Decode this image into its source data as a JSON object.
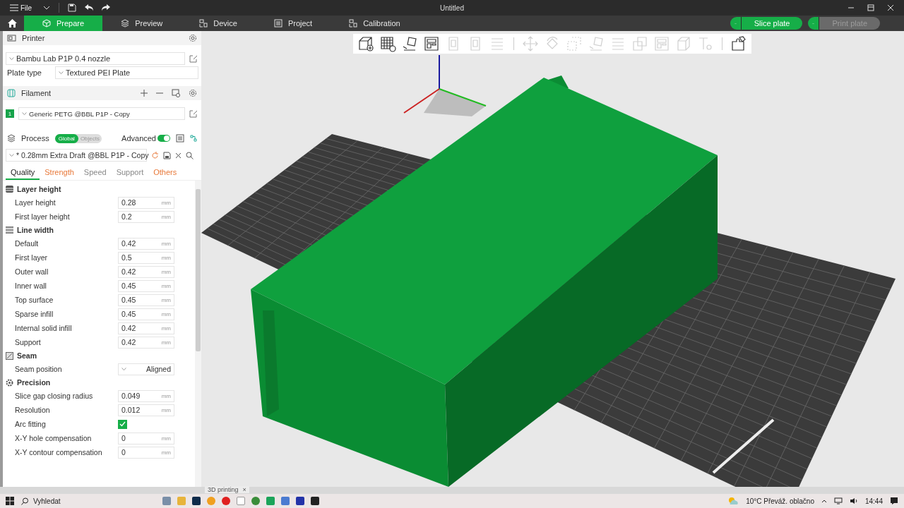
{
  "titlebar": {
    "menu": "File",
    "title": "Untitled"
  },
  "tabs": [
    {
      "label": "Prepare",
      "selected": true
    },
    {
      "label": "Preview",
      "selected": false
    },
    {
      "label": "Device",
      "selected": false
    },
    {
      "label": "Project",
      "selected": false
    },
    {
      "label": "Calibration",
      "selected": false
    }
  ],
  "actions": [
    {
      "label": "Slice plate",
      "disabled": false
    },
    {
      "label": "Print plate",
      "disabled": true
    }
  ],
  "printer": {
    "title": "Printer",
    "preset": "Bambu Lab P1P 0.4 nozzle",
    "plate_label": "Plate type",
    "plate": "Textured PEI Plate"
  },
  "filament": {
    "title": "Filament",
    "items": [
      {
        "index": "1",
        "name": "Generic PETG @BBL P1P - Copy",
        "color": "#16a34a"
      }
    ]
  },
  "process": {
    "title": "Process",
    "scopes": [
      {
        "label": "Global",
        "selected": true
      },
      {
        "label": "Objects",
        "selected": false
      }
    ],
    "advanced_label": "Advanced",
    "advanced": true,
    "preset": "* 0.28mm Extra Draft @BBL P1P - Copy"
  },
  "setting_tabs": [
    {
      "label": "Quality",
      "selected": true,
      "modified": false
    },
    {
      "label": "Strength",
      "selected": false,
      "modified": true
    },
    {
      "label": "Speed",
      "selected": false,
      "modified": false
    },
    {
      "label": "Support",
      "selected": false,
      "modified": false
    },
    {
      "label": "Others",
      "selected": false,
      "modified": true
    }
  ],
  "groups": [
    {
      "title": "Layer height",
      "kind": "layer",
      "rows": [
        {
          "kind": "number",
          "label": "Layer height",
          "value": "0.28",
          "unit": "mm"
        },
        {
          "kind": "number",
          "label": "First layer height",
          "value": "0.2",
          "unit": "mm"
        }
      ]
    },
    {
      "title": "Line width",
      "kind": "line",
      "rows": [
        {
          "kind": "number",
          "label": "Default",
          "value": "0.42",
          "unit": "mm"
        },
        {
          "kind": "number",
          "label": "First layer",
          "value": "0.5",
          "unit": "mm"
        },
        {
          "kind": "number",
          "label": "Outer wall",
          "value": "0.42",
          "unit": "mm"
        },
        {
          "kind": "number",
          "label": "Inner wall",
          "value": "0.45",
          "unit": "mm"
        },
        {
          "kind": "number",
          "label": "Top surface",
          "value": "0.45",
          "unit": "mm"
        },
        {
          "kind": "number",
          "label": "Sparse infill",
          "value": "0.45",
          "unit": "mm"
        },
        {
          "kind": "number",
          "label": "Internal solid infill",
          "value": "0.42",
          "unit": "mm"
        },
        {
          "kind": "number",
          "label": "Support",
          "value": "0.42",
          "unit": "mm"
        }
      ]
    },
    {
      "title": "Seam",
      "kind": "seam",
      "rows": [
        {
          "kind": "select",
          "label": "Seam position",
          "value": "Aligned"
        }
      ]
    },
    {
      "title": "Precision",
      "kind": "precision",
      "rows": [
        {
          "kind": "number",
          "label": "Slice gap closing radius",
          "value": "0.049",
          "unit": "mm"
        },
        {
          "kind": "number",
          "label": "Resolution",
          "value": "0.012",
          "unit": "mm"
        },
        {
          "kind": "checkbox",
          "label": "Arc fitting",
          "checked": true
        },
        {
          "kind": "number",
          "label": "X-Y hole compensation",
          "value": "0",
          "unit": "mm"
        },
        {
          "kind": "number",
          "label": "X-Y contour compensation",
          "value": "0",
          "unit": "mm"
        }
      ]
    }
  ],
  "toolbar": [
    {
      "kind": "add",
      "disabled": false
    },
    {
      "kind": "grid",
      "disabled": false
    },
    {
      "kind": "arrange",
      "disabled": false
    },
    {
      "kind": "layout",
      "disabled": false
    },
    {
      "kind": "page",
      "disabled": true
    },
    {
      "kind": "page",
      "disabled": true
    },
    {
      "kind": "lines",
      "disabled": true
    },
    {
      "kind": "move",
      "disabled": true
    },
    {
      "kind": "rotate",
      "disabled": true
    },
    {
      "kind": "scale",
      "disabled": true
    },
    {
      "kind": "arrange",
      "disabled": true
    },
    {
      "kind": "lines",
      "disabled": true
    },
    {
      "kind": "boolean",
      "disabled": true
    },
    {
      "kind": "layout",
      "disabled": true
    },
    {
      "kind": "cube",
      "disabled": true
    },
    {
      "kind": "text",
      "disabled": true
    },
    {
      "kind": "puzzle",
      "disabled": false
    }
  ],
  "document_tab": {
    "label": "3D printing",
    "close": "×"
  },
  "taskbar": {
    "search": "Vyhledat",
    "weather": "10°C Převáž. oblačno",
    "time": "14:44"
  }
}
